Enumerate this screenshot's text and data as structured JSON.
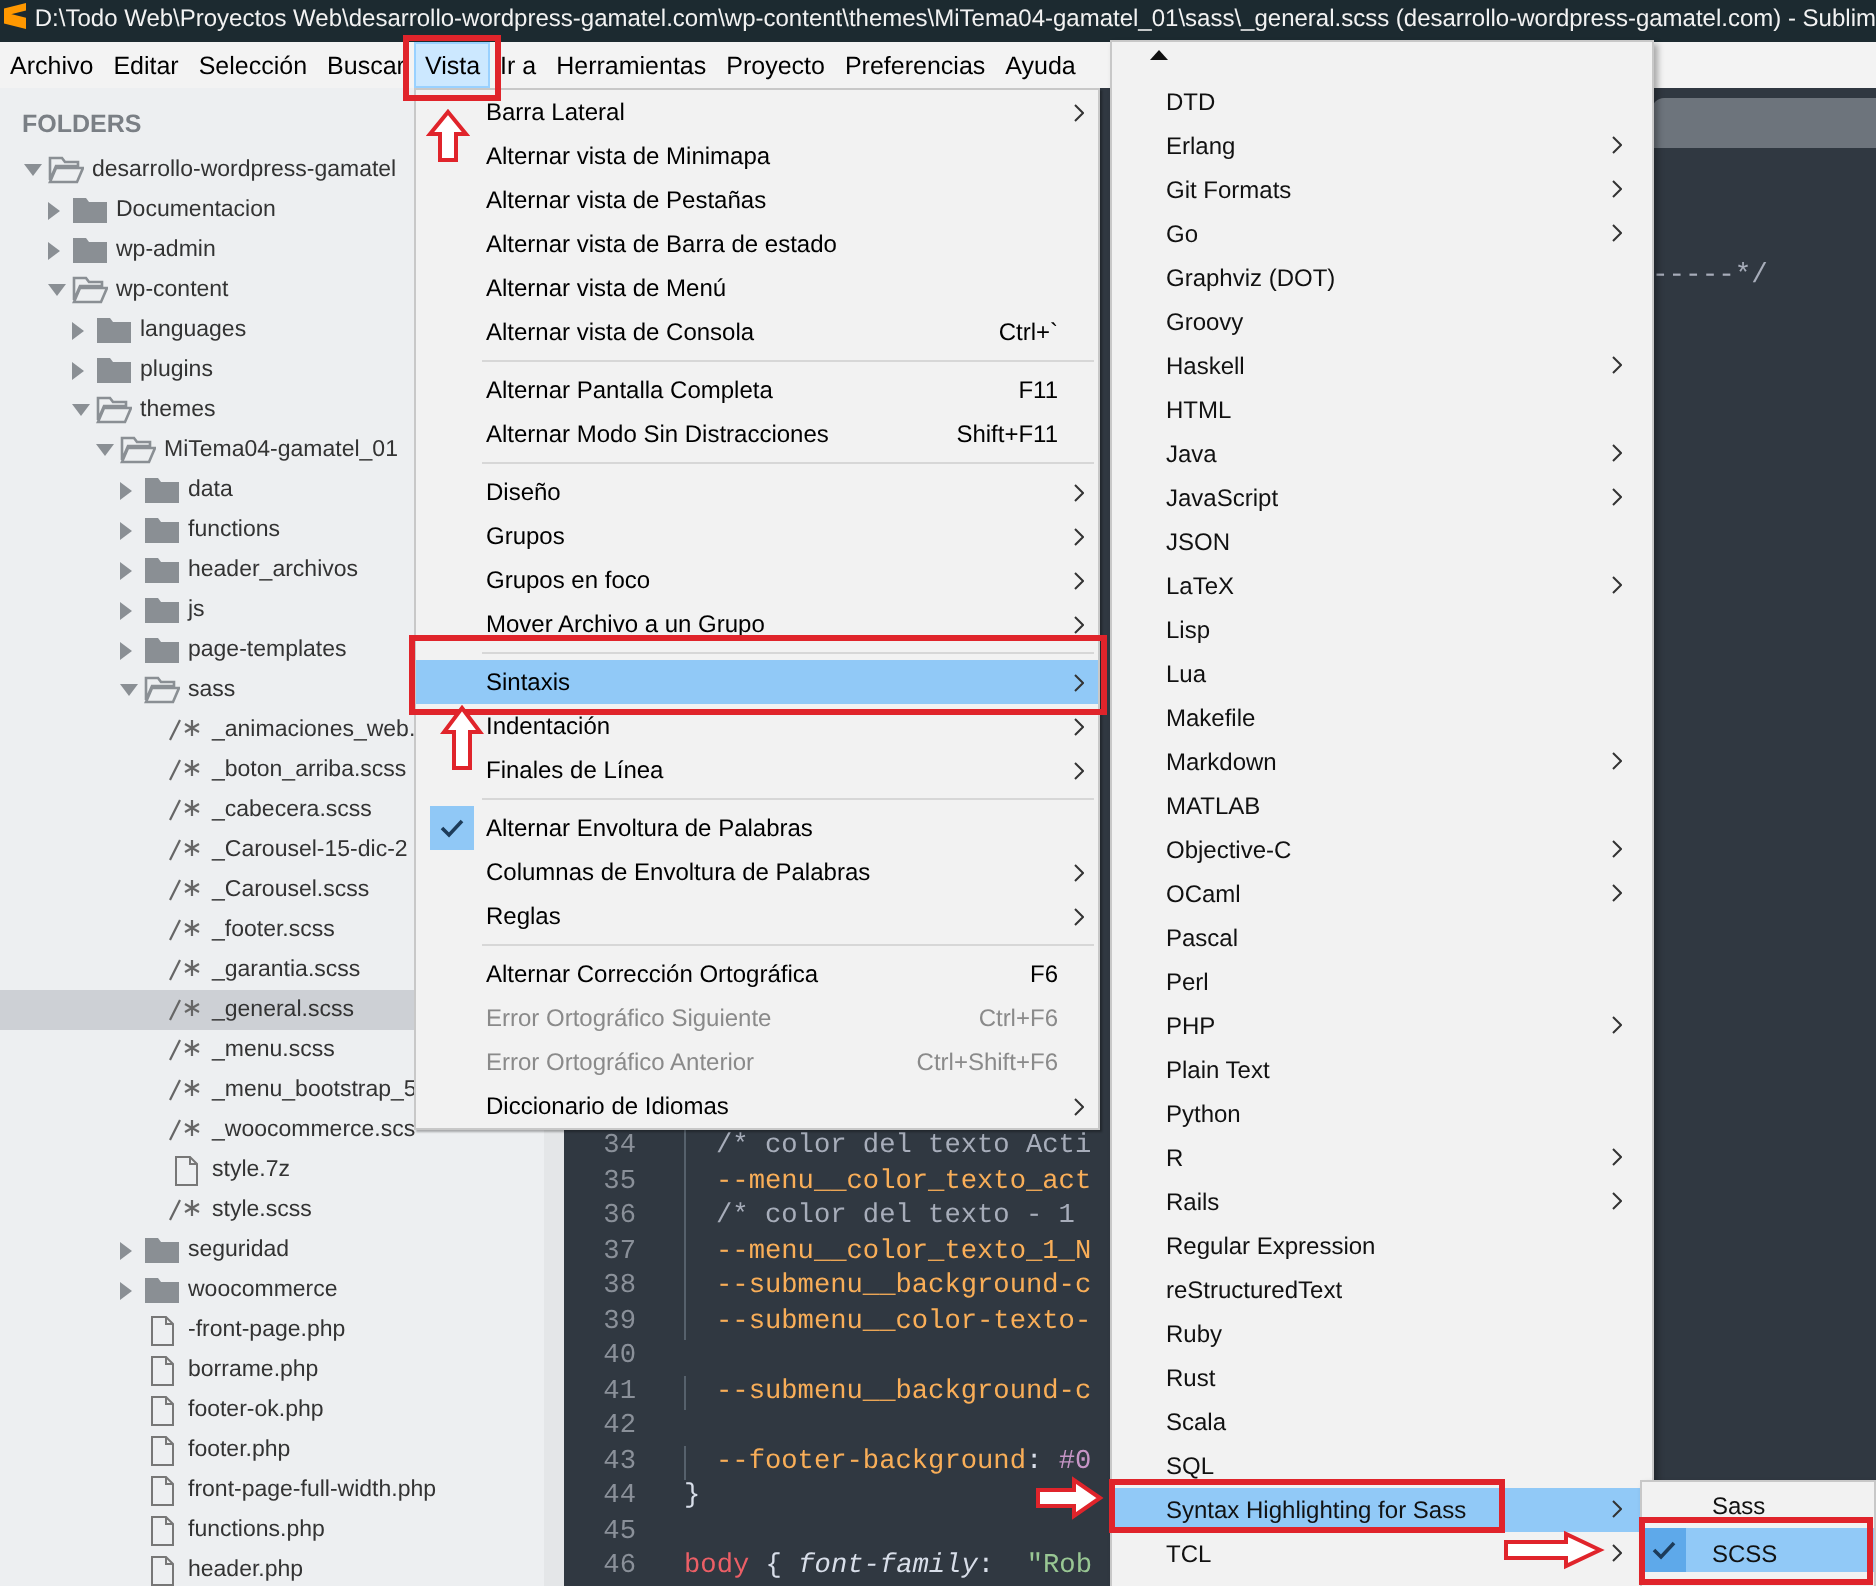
{
  "window": {
    "title": "D:\\Todo Web\\Proyectos Web\\desarrollo-wordpress-gamatel.com\\wp-content\\themes\\MiTema04-gamatel_01\\sass\\_general.scss (desarrollo-wordpress-gamatel.com) - Sublim"
  },
  "menubar": [
    {
      "label": "Archivo",
      "selected": false
    },
    {
      "label": "Editar",
      "selected": false
    },
    {
      "label": "Selección",
      "selected": false
    },
    {
      "label": "Buscar",
      "selected": false
    },
    {
      "label": "Vista",
      "selected": true
    },
    {
      "label": "Ir a",
      "selected": false
    },
    {
      "label": "Herramientas",
      "selected": false
    },
    {
      "label": "Proyecto",
      "selected": false
    },
    {
      "label": "Preferencias",
      "selected": false
    },
    {
      "label": "Ayuda",
      "selected": false
    }
  ],
  "sidebar": {
    "header": "FOLDERS",
    "tree": [
      {
        "kind": "folder",
        "name": "desarrollo-wordpress-gamatel",
        "expanded": true,
        "selected": false,
        "children": [
          {
            "kind": "folder",
            "name": "Documentacion",
            "expanded": false,
            "selected": false
          },
          {
            "kind": "folder",
            "name": "wp-admin",
            "expanded": false,
            "selected": false
          },
          {
            "kind": "folder",
            "name": "wp-content",
            "expanded": true,
            "selected": false,
            "children": [
              {
                "kind": "folder",
                "name": "languages",
                "expanded": false,
                "selected": false
              },
              {
                "kind": "folder",
                "name": "plugins",
                "expanded": false,
                "selected": false
              },
              {
                "kind": "folder",
                "name": "themes",
                "expanded": true,
                "selected": false,
                "children": [
                  {
                    "kind": "folder",
                    "name": "MiTema04-gamatel_01",
                    "expanded": true,
                    "selected": false,
                    "children": [
                      {
                        "kind": "folder",
                        "name": "data",
                        "expanded": false,
                        "selected": false
                      },
                      {
                        "kind": "folder",
                        "name": "functions",
                        "expanded": false,
                        "selected": false
                      },
                      {
                        "kind": "folder",
                        "name": "header_archivos",
                        "expanded": false,
                        "selected": false
                      },
                      {
                        "kind": "folder",
                        "name": "js",
                        "expanded": false,
                        "selected": false
                      },
                      {
                        "kind": "folder",
                        "name": "page-templates",
                        "expanded": false,
                        "selected": false
                      },
                      {
                        "kind": "folder",
                        "name": "sass",
                        "expanded": true,
                        "selected": false,
                        "children": [
                          {
                            "kind": "source",
                            "name": "_animaciones_web.",
                            "selected": false
                          },
                          {
                            "kind": "source",
                            "name": "_boton_arriba.scss",
                            "selected": false
                          },
                          {
                            "kind": "source",
                            "name": "_cabecera.scss",
                            "selected": false
                          },
                          {
                            "kind": "source",
                            "name": "_Carousel-15-dic-2",
                            "selected": false
                          },
                          {
                            "kind": "source",
                            "name": "_Carousel.scss",
                            "selected": false
                          },
                          {
                            "kind": "source",
                            "name": "_footer.scss",
                            "selected": false
                          },
                          {
                            "kind": "source",
                            "name": "_garantia.scss",
                            "selected": false
                          },
                          {
                            "kind": "source",
                            "name": "_general.scss",
                            "selected": true
                          },
                          {
                            "kind": "source",
                            "name": "_menu.scss",
                            "selected": false
                          },
                          {
                            "kind": "source",
                            "name": "_menu_bootstrap_5",
                            "selected": false
                          },
                          {
                            "kind": "source",
                            "name": "_woocommerce.scs",
                            "selected": false
                          },
                          {
                            "kind": "file",
                            "name": "style.7z",
                            "selected": false
                          },
                          {
                            "kind": "source",
                            "name": "style.scss",
                            "selected": false
                          }
                        ]
                      },
                      {
                        "kind": "folder",
                        "name": "seguridad",
                        "expanded": false,
                        "selected": false
                      },
                      {
                        "kind": "folder",
                        "name": "woocommerce",
                        "expanded": false,
                        "selected": false
                      },
                      {
                        "kind": "file",
                        "name": "-front-page.php",
                        "selected": false
                      },
                      {
                        "kind": "file",
                        "name": "borrame.php",
                        "selected": false
                      },
                      {
                        "kind": "file",
                        "name": "footer-ok.php",
                        "selected": false
                      },
                      {
                        "kind": "file",
                        "name": "footer.php",
                        "selected": false
                      },
                      {
                        "kind": "file",
                        "name": "front-page-full-width.php",
                        "selected": false
                      },
                      {
                        "kind": "file",
                        "name": "functions.php",
                        "selected": false
                      },
                      {
                        "kind": "file",
                        "name": "header.php",
                        "selected": false
                      }
                    ]
                  }
                ]
              }
            ]
          }
        ]
      }
    ]
  },
  "editor": {
    "fragment": "-----*/",
    "lines": [
      {
        "number": "34",
        "indented": true,
        "tokens": [
          {
            "kind": "comment",
            "text": "/* color del texto Acti"
          }
        ]
      },
      {
        "number": "35",
        "indented": true,
        "tokens": [
          {
            "kind": "variable",
            "text": "--menu__color_texto_act"
          }
        ]
      },
      {
        "number": "36",
        "indented": true,
        "tokens": [
          {
            "kind": "comment",
            "text": "/* color del texto - 1"
          }
        ]
      },
      {
        "number": "37",
        "indented": true,
        "tokens": [
          {
            "kind": "variable",
            "text": "--menu__color_texto_1_N"
          }
        ]
      },
      {
        "number": "38",
        "indented": true,
        "tokens": [
          {
            "kind": "variable",
            "text": "--submenu__background-c"
          }
        ]
      },
      {
        "number": "39",
        "indented": true,
        "tokens": [
          {
            "kind": "variable",
            "text": "--submenu__color-texto-"
          }
        ]
      },
      {
        "number": "40"
      },
      {
        "number": "41",
        "indented": true,
        "tokens": [
          {
            "kind": "variable",
            "text": "--submenu__background-c"
          }
        ]
      },
      {
        "number": "42"
      },
      {
        "number": "43",
        "indented": true,
        "tokens": [
          {
            "kind": "variable",
            "text": "--footer-background"
          },
          {
            "kind": "plain",
            "text": ": "
          },
          {
            "kind": "number",
            "text": "#0"
          }
        ]
      },
      {
        "number": "44",
        "indented": false,
        "tokens": [
          {
            "kind": "plain",
            "text": "}"
          }
        ]
      },
      {
        "number": "45"
      },
      {
        "number": "46",
        "indented": false,
        "tokens": [
          {
            "kind": "keyword",
            "text": "body"
          },
          {
            "kind": "plain",
            "text": " { "
          },
          {
            "kind": "property",
            "text": "font-family"
          },
          {
            "kind": "plain",
            "text": ":  "
          },
          {
            "kind": "string",
            "text": "\"Rob"
          }
        ]
      }
    ]
  },
  "view_menu": {
    "items": [
      {
        "kind": "item",
        "label": "Barra Lateral",
        "submenu": true,
        "checked": false,
        "disabled": false,
        "selected": false
      },
      {
        "kind": "item",
        "label": "Alternar vista de Minimapa",
        "submenu": false,
        "checked": false,
        "disabled": false,
        "selected": false
      },
      {
        "kind": "item",
        "label": "Alternar vista de Pestañas",
        "submenu": false,
        "checked": false,
        "disabled": false,
        "selected": false
      },
      {
        "kind": "item",
        "label": "Alternar vista de Barra de estado",
        "submenu": false,
        "checked": false,
        "disabled": false,
        "selected": false
      },
      {
        "kind": "item",
        "label": "Alternar vista de Menú",
        "submenu": false,
        "checked": false,
        "disabled": false,
        "selected": false
      },
      {
        "kind": "item",
        "label": "Alternar vista de Consola",
        "shortcut": "Ctrl+`",
        "submenu": false,
        "checked": false,
        "disabled": false,
        "selected": false
      },
      {
        "kind": "separator"
      },
      {
        "kind": "item",
        "label": "Alternar Pantalla Completa",
        "shortcut": "F11",
        "submenu": false,
        "checked": false,
        "disabled": false,
        "selected": false
      },
      {
        "kind": "item",
        "label": "Alternar Modo Sin Distracciones",
        "shortcut": "Shift+F11",
        "submenu": false,
        "checked": false,
        "disabled": false,
        "selected": false
      },
      {
        "kind": "separator"
      },
      {
        "kind": "item",
        "label": "Diseño",
        "submenu": true,
        "checked": false,
        "disabled": false,
        "selected": false
      },
      {
        "kind": "item",
        "label": "Grupos",
        "submenu": true,
        "checked": false,
        "disabled": false,
        "selected": false
      },
      {
        "kind": "item",
        "label": "Grupos en foco",
        "submenu": true,
        "checked": false,
        "disabled": false,
        "selected": false
      },
      {
        "kind": "item",
        "label": "Mover Archivo a un Grupo",
        "submenu": true,
        "checked": false,
        "disabled": false,
        "selected": false
      },
      {
        "kind": "separator"
      },
      {
        "kind": "item",
        "label": "Sintaxis",
        "submenu": true,
        "checked": false,
        "disabled": false,
        "selected": true
      },
      {
        "kind": "item",
        "label": "Indentación",
        "submenu": true,
        "checked": false,
        "disabled": false,
        "selected": false
      },
      {
        "kind": "item",
        "label": "Finales de Línea",
        "submenu": true,
        "checked": false,
        "disabled": false,
        "selected": false
      },
      {
        "kind": "separator"
      },
      {
        "kind": "item",
        "label": "Alternar Envoltura de Palabras",
        "submenu": false,
        "checked": true,
        "disabled": false,
        "selected": false
      },
      {
        "kind": "item",
        "label": "Columnas de Envoltura de Palabras",
        "submenu": true,
        "checked": false,
        "disabled": false,
        "selected": false
      },
      {
        "kind": "item",
        "label": "Reglas",
        "submenu": true,
        "checked": false,
        "disabled": false,
        "selected": false
      },
      {
        "kind": "separator"
      },
      {
        "kind": "item",
        "label": "Alternar Corrección Ortográfica",
        "shortcut": "F6",
        "submenu": false,
        "checked": false,
        "disabled": false,
        "selected": false
      },
      {
        "kind": "item",
        "label": "Error Ortográfico Siguiente",
        "shortcut": "Ctrl+F6",
        "submenu": false,
        "checked": false,
        "disabled": true,
        "selected": false
      },
      {
        "kind": "item",
        "label": "Error Ortográfico Anterior",
        "shortcut": "Ctrl+Shift+F6",
        "submenu": false,
        "checked": false,
        "disabled": true,
        "selected": false
      },
      {
        "kind": "item",
        "label": "Diccionario de Idiomas",
        "submenu": true,
        "checked": false,
        "disabled": false,
        "selected": false
      }
    ]
  },
  "syntax_menu": {
    "items": [
      {
        "label": "DTD",
        "submenu": false,
        "selected": false
      },
      {
        "label": "Erlang",
        "submenu": true,
        "selected": false
      },
      {
        "label": "Git Formats",
        "submenu": true,
        "selected": false
      },
      {
        "label": "Go",
        "submenu": true,
        "selected": false
      },
      {
        "label": "Graphviz (DOT)",
        "submenu": false,
        "selected": false
      },
      {
        "label": "Groovy",
        "submenu": false,
        "selected": false
      },
      {
        "label": "Haskell",
        "submenu": true,
        "selected": false
      },
      {
        "label": "HTML",
        "submenu": false,
        "selected": false
      },
      {
        "label": "Java",
        "submenu": true,
        "selected": false
      },
      {
        "label": "JavaScript",
        "submenu": true,
        "selected": false
      },
      {
        "label": "JSON",
        "submenu": false,
        "selected": false
      },
      {
        "label": "LaTeX",
        "submenu": true,
        "selected": false
      },
      {
        "label": "Lisp",
        "submenu": false,
        "selected": false
      },
      {
        "label": "Lua",
        "submenu": false,
        "selected": false
      },
      {
        "label": "Makefile",
        "submenu": false,
        "selected": false
      },
      {
        "label": "Markdown",
        "submenu": true,
        "selected": false
      },
      {
        "label": "MATLAB",
        "submenu": false,
        "selected": false
      },
      {
        "label": "Objective-C",
        "submenu": true,
        "selected": false
      },
      {
        "label": "OCaml",
        "submenu": true,
        "selected": false
      },
      {
        "label": "Pascal",
        "submenu": false,
        "selected": false
      },
      {
        "label": "Perl",
        "submenu": false,
        "selected": false
      },
      {
        "label": "PHP",
        "submenu": true,
        "selected": false
      },
      {
        "label": "Plain Text",
        "submenu": false,
        "selected": false
      },
      {
        "label": "Python",
        "submenu": false,
        "selected": false
      },
      {
        "label": "R",
        "submenu": true,
        "selected": false
      },
      {
        "label": "Rails",
        "submenu": true,
        "selected": false
      },
      {
        "label": "Regular Expression",
        "submenu": false,
        "selected": false
      },
      {
        "label": "reStructuredText",
        "submenu": false,
        "selected": false
      },
      {
        "label": "Ruby",
        "submenu": false,
        "selected": false
      },
      {
        "label": "Rust",
        "submenu": false,
        "selected": false
      },
      {
        "label": "Scala",
        "submenu": false,
        "selected": false
      },
      {
        "label": "SQL",
        "submenu": false,
        "selected": false
      },
      {
        "label": "Syntax Highlighting for Sass",
        "submenu": true,
        "selected": true
      },
      {
        "label": "TCL",
        "submenu": true,
        "selected": false
      }
    ]
  },
  "sass_menu": {
    "items": [
      {
        "label": "Sass",
        "checked": false,
        "selected": false
      },
      {
        "label": "SCSS",
        "checked": true,
        "selected": true
      }
    ]
  }
}
